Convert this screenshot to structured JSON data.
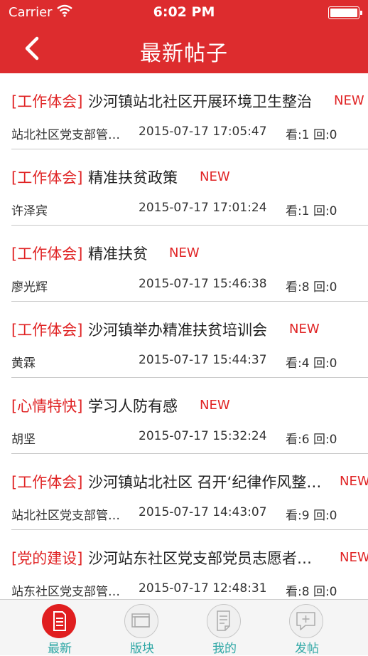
{
  "status_bar": {
    "carrier": "Carrier",
    "time": "6:02 PM"
  },
  "nav": {
    "title": "最新帖子"
  },
  "posts": [
    {
      "category": "[工作体会]",
      "title": "沙河镇站北社区开展环境卫生整治",
      "badge": "NEW",
      "author": "站北社区党支部管…",
      "date": "2015-07-17 17:05:47",
      "stats": "看:1 回:0"
    },
    {
      "category": "[工作体会]",
      "title": "精准扶贫政策",
      "badge": "NEW",
      "author": "许泽宾",
      "date": "2015-07-17 17:01:24",
      "stats": "看:1 回:0"
    },
    {
      "category": "[工作体会]",
      "title": "精准扶贫",
      "badge": "NEW",
      "author": "廖光辉",
      "date": "2015-07-17 15:46:38",
      "stats": "看:8 回:0"
    },
    {
      "category": "[工作体会]",
      "title": "沙河镇举办精准扶贫培训会",
      "badge": "NEW",
      "author": "黄霖",
      "date": "2015-07-17 15:44:37",
      "stats": "看:4 回:0"
    },
    {
      "category": "[心情特快]",
      "title": "学习人防有感",
      "badge": "NEW",
      "author": "胡坚",
      "date": "2015-07-17 15:32:24",
      "stats": "看:6 回:0"
    },
    {
      "category": "[工作体会]",
      "title": "沙河镇站北社区 召开‘纪律作风整…",
      "badge": "NEW",
      "author": "站北社区党支部管…",
      "date": "2015-07-17 14:43:07",
      "stats": "看:9 回:0"
    },
    {
      "category": "[党的建设]",
      "title": "沙河站东社区党支部党员志愿者…",
      "badge": "NEW",
      "author": "站东社区党支部管…",
      "date": "2015-07-17 12:48:31",
      "stats": "看:8 回:0"
    }
  ],
  "tabs": [
    {
      "label": "最新",
      "icon": "document-icon"
    },
    {
      "label": "版块",
      "icon": "windows-icon"
    },
    {
      "label": "我的",
      "icon": "note-icon"
    },
    {
      "label": "发帖",
      "icon": "compose-icon"
    }
  ],
  "colors": {
    "header": "#dd2c2e",
    "accent": "#e02425",
    "tab_label": "#2ea7a5"
  }
}
